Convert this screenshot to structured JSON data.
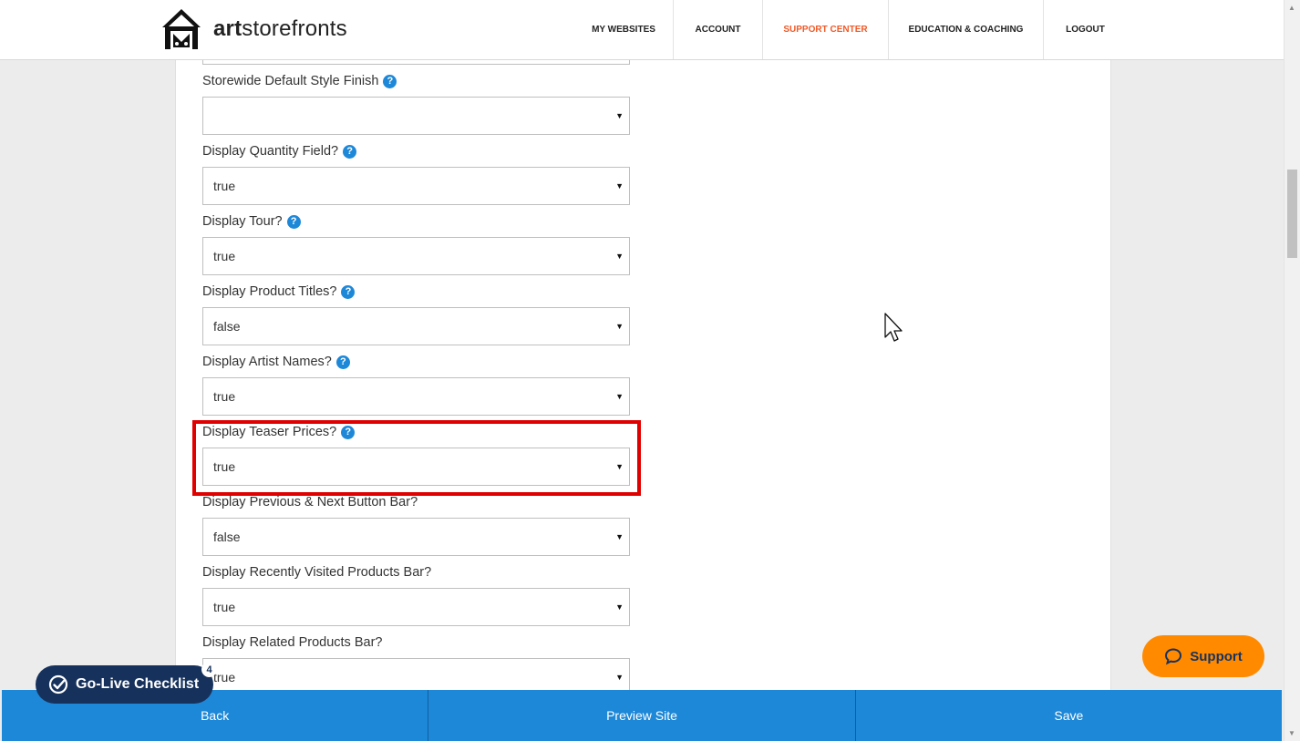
{
  "header": {
    "logo_text_bold": "art",
    "logo_text_rest": "storefronts",
    "nav": [
      {
        "label": "MY WEBSITES",
        "active": false
      },
      {
        "label": "ACCOUNT",
        "active": false
      },
      {
        "label": "SUPPORT CENTER",
        "active": true
      },
      {
        "label": "EDUCATION & COACHING",
        "active": false
      },
      {
        "label": "LOGOUT",
        "active": false
      }
    ]
  },
  "fields": [
    {
      "label": "Storewide Default Style Finish",
      "help": true,
      "value": ""
    },
    {
      "label": "Display Quantity Field?",
      "help": true,
      "value": "true"
    },
    {
      "label": "Display Tour?",
      "help": true,
      "value": "true"
    },
    {
      "label": "Display Product Titles?",
      "help": true,
      "value": "false"
    },
    {
      "label": "Display Artist Names?",
      "help": true,
      "value": "true"
    },
    {
      "label": "Display Teaser Prices?",
      "help": true,
      "value": "true"
    },
    {
      "label": "Display Previous & Next Button Bar?",
      "help": false,
      "value": "false"
    },
    {
      "label": "Display Recently Visited Products Bar?",
      "help": false,
      "value": "true"
    },
    {
      "label": "Display Related Products Bar?",
      "help": false,
      "value": "true"
    }
  ],
  "help_glyph": "?",
  "select_arrow": "▼",
  "footer": {
    "back": "Back",
    "preview": "Preview Site",
    "save": "Save"
  },
  "golive": {
    "label": "Go-Live Checklist",
    "count": "4"
  },
  "support": {
    "label": "Support"
  },
  "colors": {
    "accent": "#1e88d8",
    "active_nav": "#f05a28",
    "support": "#ff8a00",
    "highlight": "#e00000",
    "golive": "#16325c"
  }
}
